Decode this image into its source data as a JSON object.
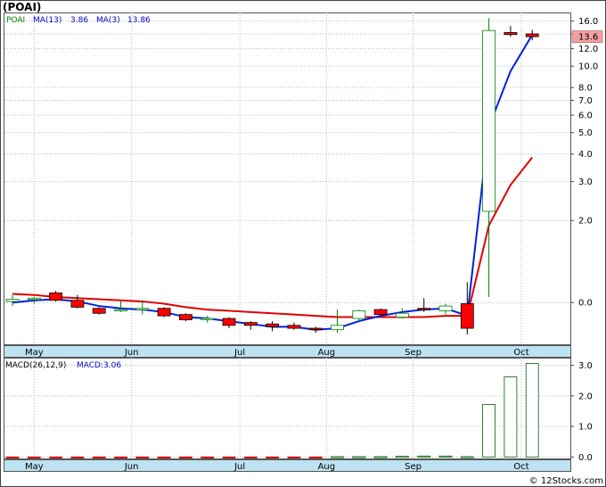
{
  "header": {
    "title": "(POAI)"
  },
  "chart_data": [
    {
      "type": "candlestick",
      "panel": "price",
      "y_scale": "log",
      "ylim": [
        0.55,
        17.5
      ],
      "y_ticks": [
        "0.0",
        "2.0",
        "3.0",
        "4.0",
        "5.0",
        "6.0",
        "7.0",
        "8.0",
        "10.0",
        "12.0",
        "14.0",
        "16.0"
      ],
      "y_tick_values": [
        0.85,
        2.0,
        3.0,
        4.0,
        5.0,
        6.0,
        7.0,
        8.0,
        10.0,
        12.0,
        14.0,
        16.0
      ],
      "last_price_label": "13.6",
      "last_price": 13.6,
      "legend": {
        "symbol": "POAI",
        "ma13_label": "MA(13)",
        "ma13_value": "3.86",
        "ma3_label": "MA(3)",
        "ma3_value": "13.86"
      },
      "x_labels": [
        "May",
        "Jun",
        "Jul",
        "Aug",
        "Sep",
        "Oct"
      ],
      "x_label_week": [
        1,
        5.5,
        10.5,
        14.5,
        18.5,
        23.5
      ],
      "weeks": [
        0,
        1,
        2,
        3,
        4,
        5,
        6,
        7,
        8,
        9,
        10,
        11,
        12,
        13,
        14,
        15,
        16,
        17,
        18,
        19,
        20,
        21,
        22,
        23,
        24
      ],
      "candles": [
        {
          "o": 0.86,
          "h": 0.92,
          "l": 0.82,
          "c": 0.88
        },
        {
          "o": 0.88,
          "h": 0.9,
          "l": 0.84,
          "c": 0.89
        },
        {
          "o": 0.94,
          "h": 0.96,
          "l": 0.86,
          "c": 0.87
        },
        {
          "o": 0.87,
          "h": 0.92,
          "l": 0.8,
          "c": 0.81
        },
        {
          "o": 0.8,
          "h": 0.81,
          "l": 0.75,
          "c": 0.76
        },
        {
          "o": 0.78,
          "h": 0.87,
          "l": 0.77,
          "c": 0.79
        },
        {
          "o": 0.79,
          "h": 0.87,
          "l": 0.75,
          "c": 0.8
        },
        {
          "o": 0.8,
          "h": 0.81,
          "l": 0.73,
          "c": 0.74
        },
        {
          "o": 0.75,
          "h": 0.76,
          "l": 0.7,
          "c": 0.71
        },
        {
          "o": 0.71,
          "h": 0.74,
          "l": 0.69,
          "c": 0.72
        },
        {
          "o": 0.72,
          "h": 0.73,
          "l": 0.65,
          "c": 0.67
        },
        {
          "o": 0.69,
          "h": 0.7,
          "l": 0.64,
          "c": 0.67
        },
        {
          "o": 0.68,
          "h": 0.7,
          "l": 0.63,
          "c": 0.66
        },
        {
          "o": 0.67,
          "h": 0.69,
          "l": 0.64,
          "c": 0.65
        },
        {
          "o": 0.65,
          "h": 0.66,
          "l": 0.62,
          "c": 0.64
        },
        {
          "o": 0.64,
          "h": 0.79,
          "l": 0.62,
          "c": 0.67
        },
        {
          "o": 0.72,
          "h": 0.79,
          "l": 0.7,
          "c": 0.78
        },
        {
          "o": 0.79,
          "h": 0.8,
          "l": 0.74,
          "c": 0.75
        },
        {
          "o": 0.73,
          "h": 0.8,
          "l": 0.72,
          "c": 0.76
        },
        {
          "o": 0.8,
          "h": 0.89,
          "l": 0.77,
          "c": 0.79
        },
        {
          "o": 0.78,
          "h": 0.84,
          "l": 0.75,
          "c": 0.82
        },
        {
          "o": 0.84,
          "h": 1.05,
          "l": 0.61,
          "c": 0.65
        },
        {
          "o": 2.2,
          "h": 16.5,
          "l": 0.9,
          "c": 14.5
        },
        {
          "o": 14.2,
          "h": 15.2,
          "l": 13.6,
          "c": 13.9
        },
        {
          "o": 14.0,
          "h": 14.6,
          "l": 13.1,
          "c": 13.6
        }
      ],
      "ma13": [
        0.93,
        0.92,
        0.9,
        0.89,
        0.88,
        0.87,
        0.86,
        0.84,
        0.81,
        0.79,
        0.78,
        0.77,
        0.76,
        0.75,
        0.74,
        0.73,
        0.73,
        0.73,
        0.73,
        0.73,
        0.74,
        0.74,
        1.9,
        2.9,
        3.86
      ],
      "ma3": [
        0.85,
        0.87,
        0.88,
        0.86,
        0.82,
        0.8,
        0.79,
        0.77,
        0.73,
        0.72,
        0.7,
        0.68,
        0.66,
        0.66,
        0.64,
        0.65,
        0.7,
        0.74,
        0.77,
        0.79,
        0.8,
        0.74,
        5.3,
        9.5,
        13.86
      ],
      "colors": {
        "up_body": "#ffffff",
        "up_edge": "#008000",
        "down_body": "#ff0000",
        "down_edge": "#000000",
        "ma13": "#e00000",
        "ma3": "#0020e0",
        "last_price_box": "#f4a0a0",
        "axis_band": "#bde2f2"
      }
    },
    {
      "type": "bar",
      "panel": "macd",
      "legend": {
        "label": "MACD(26,12,9)",
        "value_label": "MACD:3.06"
      },
      "ylim": [
        -0.05,
        3.25
      ],
      "y_ticks": [
        "0.0",
        "1.0",
        "2.0",
        "3.0"
      ],
      "y_tick_values": [
        0,
        1,
        2,
        3
      ],
      "x_labels": [
        "May",
        "Jun",
        "Jul",
        "Aug",
        "Sep",
        "Oct"
      ],
      "values": [
        -0.03,
        -0.03,
        -0.03,
        -0.03,
        -0.03,
        -0.03,
        -0.03,
        -0.03,
        -0.03,
        -0.03,
        -0.03,
        -0.03,
        -0.03,
        -0.03,
        -0.03,
        0.01,
        0.01,
        0.01,
        0.02,
        0.03,
        0.03,
        0.01,
        1.72,
        2.62,
        3.06
      ],
      "colors": {
        "positive_edge": "#006000",
        "negative": "#cc0000"
      }
    }
  ],
  "footer": {
    "watermark": "© 12Stocks.com"
  }
}
